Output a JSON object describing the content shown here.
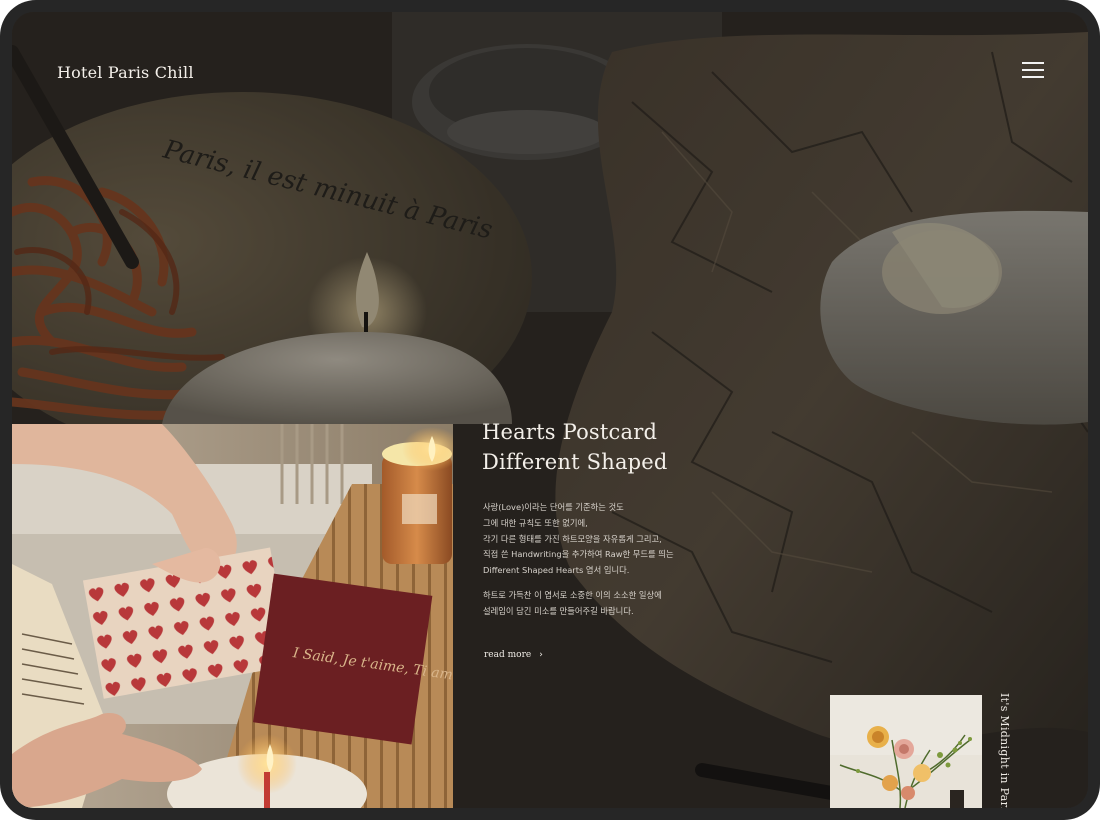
{
  "header": {
    "brand": "Hotel Paris Chill",
    "menu_icon": "hamburger-menu-icon"
  },
  "article": {
    "title_lines": [
      "Hearts Postcard",
      "Different Shaped"
    ],
    "paragraph1_lines": [
      "사랑(Love)이라는 단어를 기준하는 것도",
      "그에 대한 규칙도 또한 없기에,",
      "각기 다른 형태를 가진 하트모양을 자유롭게 그리고,",
      "직접 쓴 Handwriting을 추가하여 Raw한 무드를 띄는",
      "Different Shaped Hearts 엽서 입니다."
    ],
    "paragraph2_lines": [
      "하트로 가득찬 이 엽서로 소중한 이의 소소한 일상에",
      "설레임이 담긴 미소를 만들어주길 바랍니다."
    ],
    "read_more": "read more",
    "read_more_icon": "chevron-right-icon"
  },
  "side": {
    "vertical_text": "It's Midnight in Paris"
  },
  "hero": {
    "plate_script": "Paris, il est minuit à Paris"
  },
  "feature_photo": {
    "postcard_script": "I Said, Je t'aime, Ti amo, Te quiero"
  },
  "colors": {
    "frame": "#262626",
    "overlay": "#0a0a0a",
    "text_light": "#f3efe9"
  }
}
